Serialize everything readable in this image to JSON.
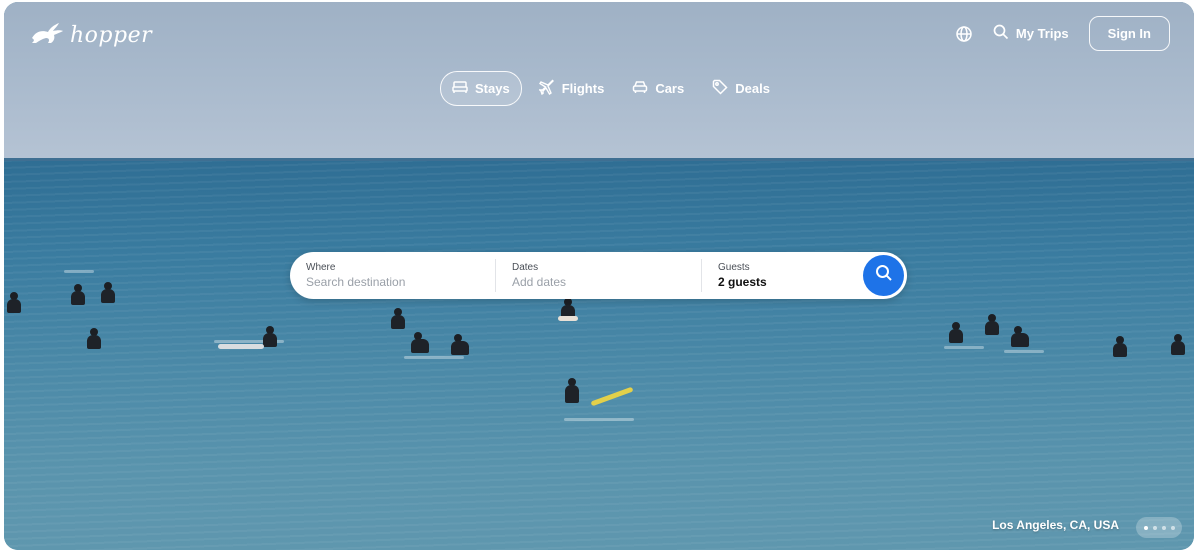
{
  "brand": {
    "name": "hopper",
    "logo_icon": "bunny-icon"
  },
  "header": {
    "language_icon": "globe-icon",
    "my_trips_label": "My Trips",
    "my_trips_icon": "search-icon",
    "sign_in_label": "Sign In"
  },
  "tabs": [
    {
      "label": "Stays",
      "icon": "bed-icon",
      "active": true
    },
    {
      "label": "Flights",
      "icon": "plane-icon",
      "active": false
    },
    {
      "label": "Cars",
      "icon": "car-icon",
      "active": false
    },
    {
      "label": "Deals",
      "icon": "tag-icon",
      "active": false
    }
  ],
  "search": {
    "where_label": "Where",
    "where_placeholder": "Search destination",
    "dates_label": "Dates",
    "dates_placeholder": "Add dates",
    "guests_label": "Guests",
    "guests_value": "2 guests",
    "search_button_icon": "search-icon",
    "accent_color": "#1e73e8"
  },
  "hero": {
    "location": "Los Angeles, CA, USA",
    "carousel_dots": 4,
    "active_dot": 0
  }
}
